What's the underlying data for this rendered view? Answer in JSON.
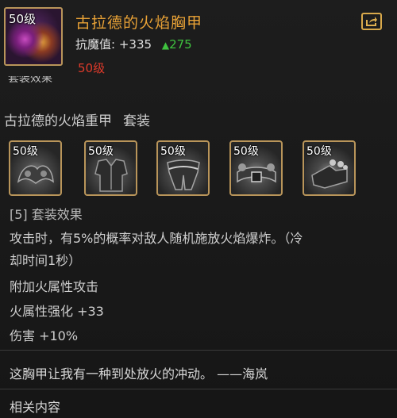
{
  "item": {
    "level_badge": "50级",
    "name": "古拉德的火焰胸甲",
    "stat_label": "抗魔值:",
    "stat_value": "+335",
    "stat_delta": "275",
    "required_level": "50级"
  },
  "truncated_heading": "套装效果",
  "set": {
    "name": "古拉德的火焰重甲",
    "tag": "套装",
    "pieces": [
      {
        "level": "50级",
        "icon": "shoulder-armor-icon"
      },
      {
        "level": "50级",
        "icon": "chest-armor-icon"
      },
      {
        "level": "50级",
        "icon": "pants-armor-icon"
      },
      {
        "level": "50级",
        "icon": "belt-armor-icon"
      },
      {
        "level": "50级",
        "icon": "boots-armor-icon"
      }
    ]
  },
  "effect": {
    "header": "[5] 套装效果",
    "desc_line1": "攻击时，有5%的概率对敌人随机施放火焰爆炸。（冷",
    "desc_line2": "却时间1秒）",
    "attack": "附加火属性攻击",
    "fire_boost": "火属性强化 +33",
    "damage": "伤害 +10%"
  },
  "flavor": "这胸甲让我有一种到处放火的冲动。 ——海岚",
  "related": "相关内容",
  "colors": {
    "title": "#e9a236",
    "frame": "#b9955a",
    "increase": "#3fc23f",
    "required_level": "#e03a2a"
  }
}
